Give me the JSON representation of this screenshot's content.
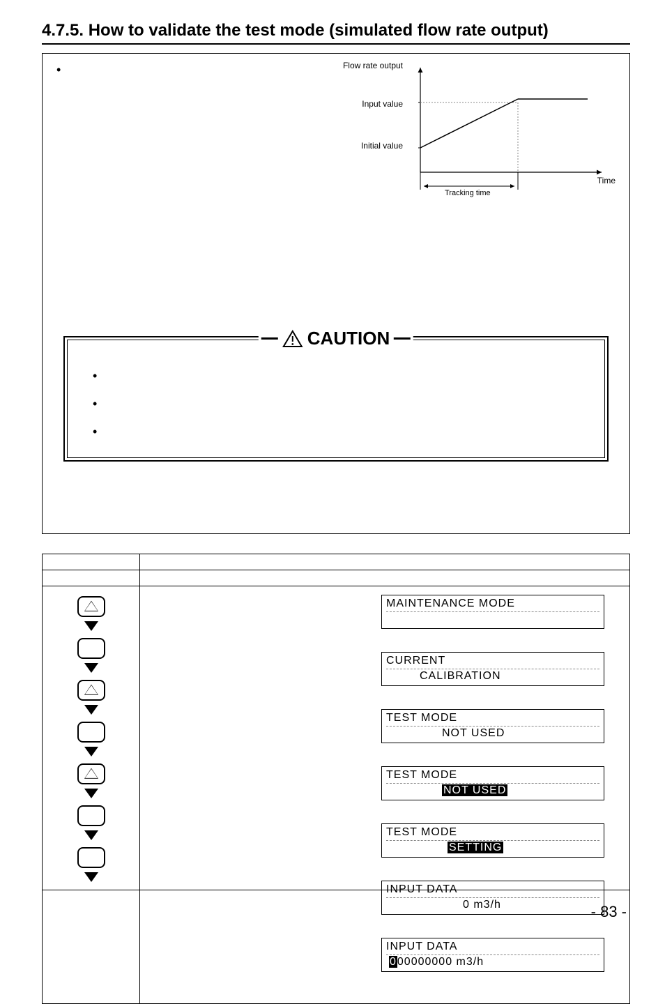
{
  "title": "4.7.5. How to validate the test mode (simulated flow rate output)",
  "chart_data": {
    "type": "line",
    "y_axis_top_label": "Flow rate output",
    "y_ticks": [
      "Input value",
      "Initial value"
    ],
    "x_axis_label": "Time",
    "x_span_label": "Tracking time",
    "series": [
      {
        "name": "ramp",
        "points_description": "rises linearly from Initial value at t=0 to Input value at t=Tracking time, then holds constant"
      }
    ]
  },
  "caution": {
    "label": "CAUTION",
    "bullets": [
      "•",
      "•",
      "•"
    ]
  },
  "steps": [
    {
      "key": "up-hollow",
      "lcd": {
        "line1": "MAINTENANCE  MODE",
        "line2": ""
      }
    },
    {
      "key": "blank",
      "lcd": {
        "line1": "CURRENT",
        "line2": "CALIBRATION"
      }
    },
    {
      "key": "up-hollow",
      "lcd": {
        "line1": "TEST  MODE",
        "line2": "NOT  USED"
      }
    },
    {
      "key": "blank",
      "lcd": {
        "line1": "TEST  MODE",
        "line2_pre": "",
        "line2_inv": "NOT  USED",
        "line2_post": ""
      }
    },
    {
      "key": "up-hollow",
      "lcd": {
        "line1": "TEST  MODE",
        "line2_pre": "",
        "line2_inv": "SETTING",
        "line2_post": ""
      }
    },
    {
      "key": "blank",
      "lcd": {
        "line1": "INPUT  DATA",
        "line2_value": "0   m3/h"
      }
    },
    {
      "key": "blank",
      "lcd": {
        "line1": "INPUT  DATA",
        "line2_char_inv": "0",
        "line2_after": "00000000   m3/h",
        "line2_noindent": true
      }
    }
  ],
  "page_number": "- 83 -"
}
